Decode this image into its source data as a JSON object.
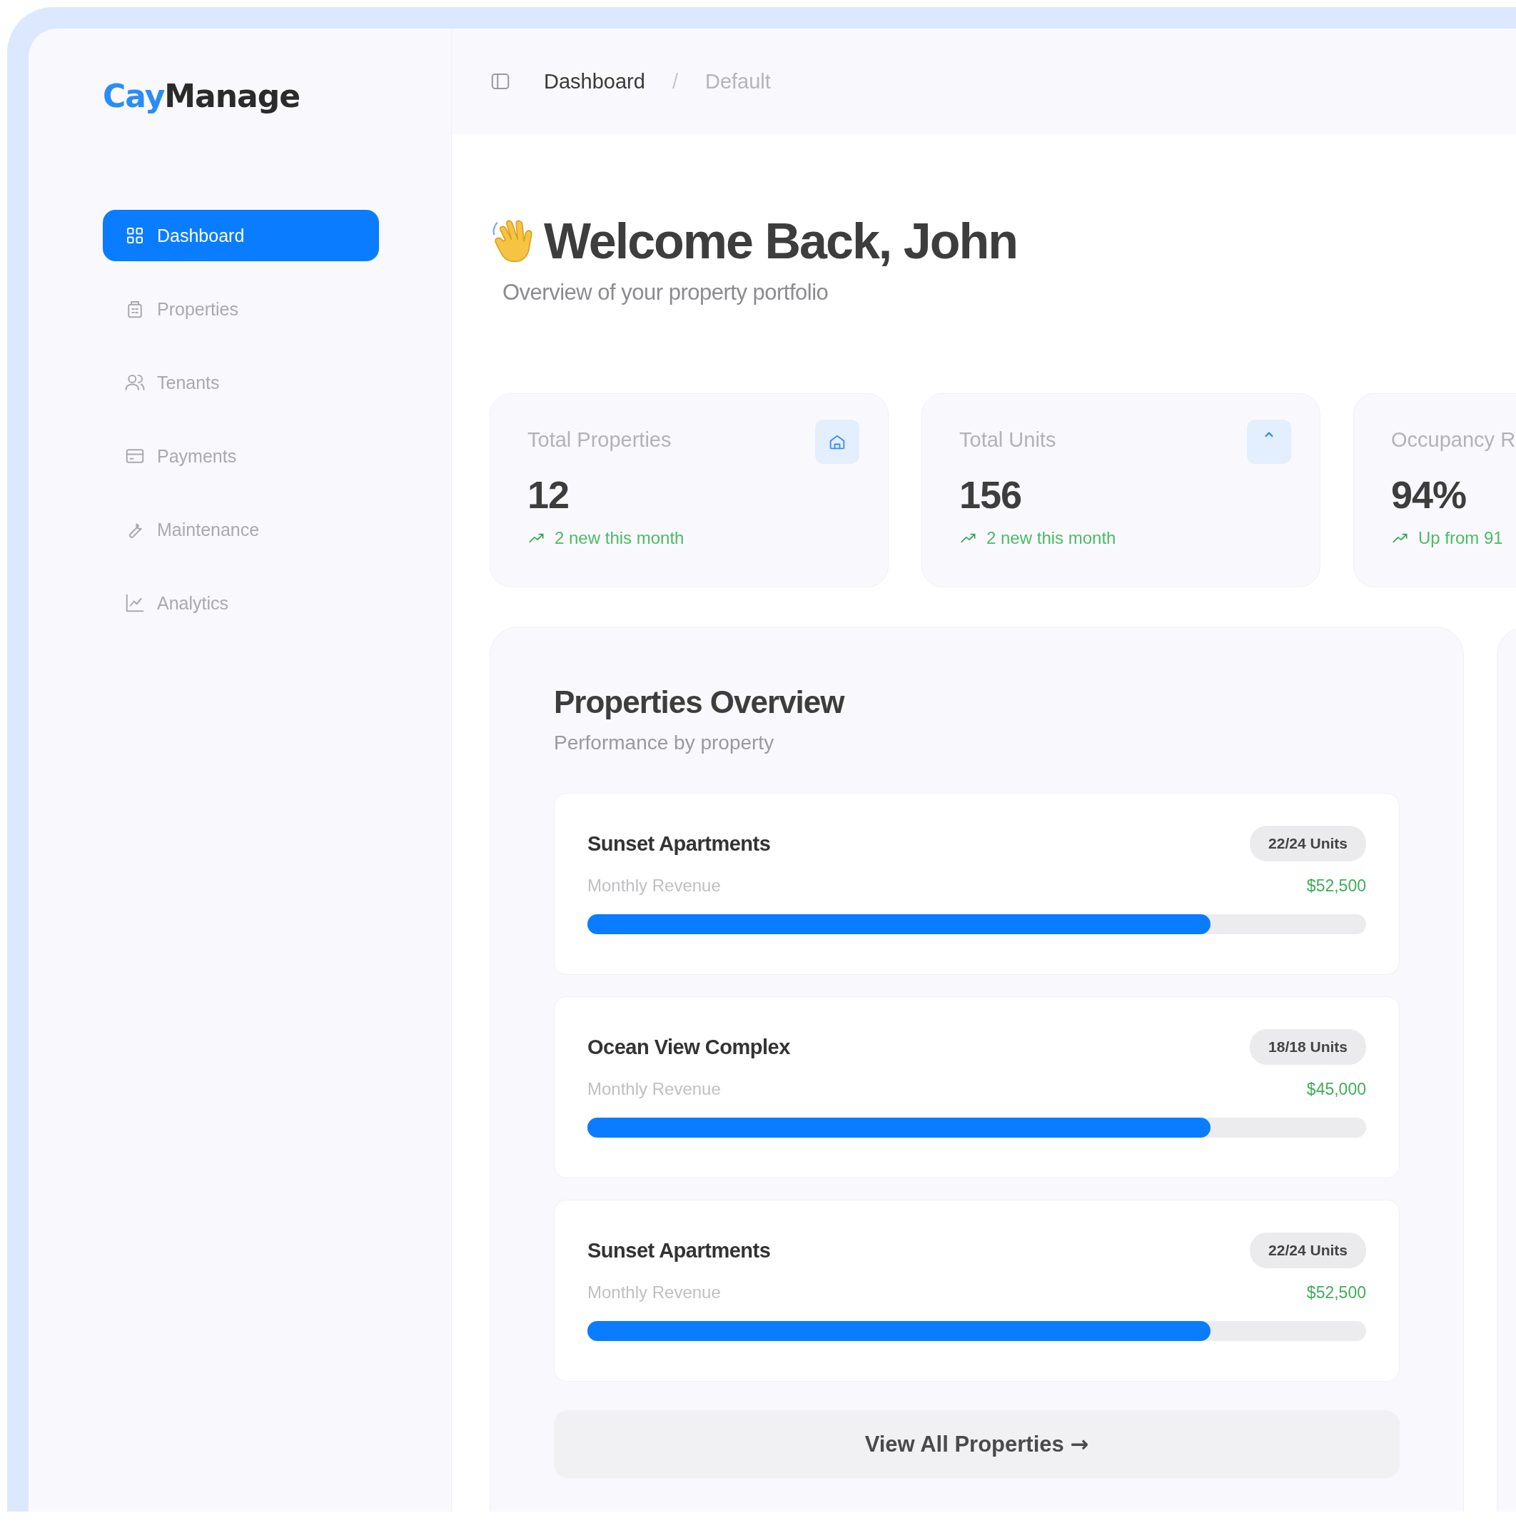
{
  "brand": {
    "accent": "Cay",
    "rest": "Manage"
  },
  "sidebar": {
    "items": [
      {
        "label": "Dashboard",
        "selected": true
      },
      {
        "label": "Properties",
        "selected": false
      },
      {
        "label": "Tenants",
        "selected": false
      },
      {
        "label": "Payments",
        "selected": false
      },
      {
        "label": "Maintenance",
        "selected": false
      },
      {
        "label": "Analytics",
        "selected": false
      }
    ]
  },
  "breadcrumb": {
    "items": [
      "Dashboard",
      "Default"
    ],
    "separator": "/"
  },
  "greeting": {
    "title": "Welcome Back, John",
    "subtitle": "Overview of your property portfolio"
  },
  "stats": [
    {
      "label": "Total Properties",
      "value": "12",
      "trend": "2 new this month"
    },
    {
      "label": "Total Units",
      "value": "156",
      "trend": "2 new this month"
    },
    {
      "label": "Occupancy R",
      "value": "94%",
      "trend": "Up from 91"
    }
  ],
  "properties_overview": {
    "title": "Properties Overview",
    "subtitle": "Performance by property",
    "properties": [
      {
        "name": "Sunset Apartments",
        "units": "22/24 Units",
        "revenue_label": "Monthly Revenue",
        "revenue": "$52,500",
        "level": 0.8
      },
      {
        "name": "Ocean View Complex",
        "units": "18/18 Units",
        "revenue_label": "Monthly Revenue",
        "revenue": "$45,000",
        "level": 0.8
      },
      {
        "name": "Sunset Apartments",
        "units": "22/24 Units",
        "revenue_label": "Monthly Revenue",
        "revenue": "$52,500",
        "level": 0.8
      }
    ],
    "button": {
      "label": "View All Properties",
      "arrow": "→"
    }
  }
}
